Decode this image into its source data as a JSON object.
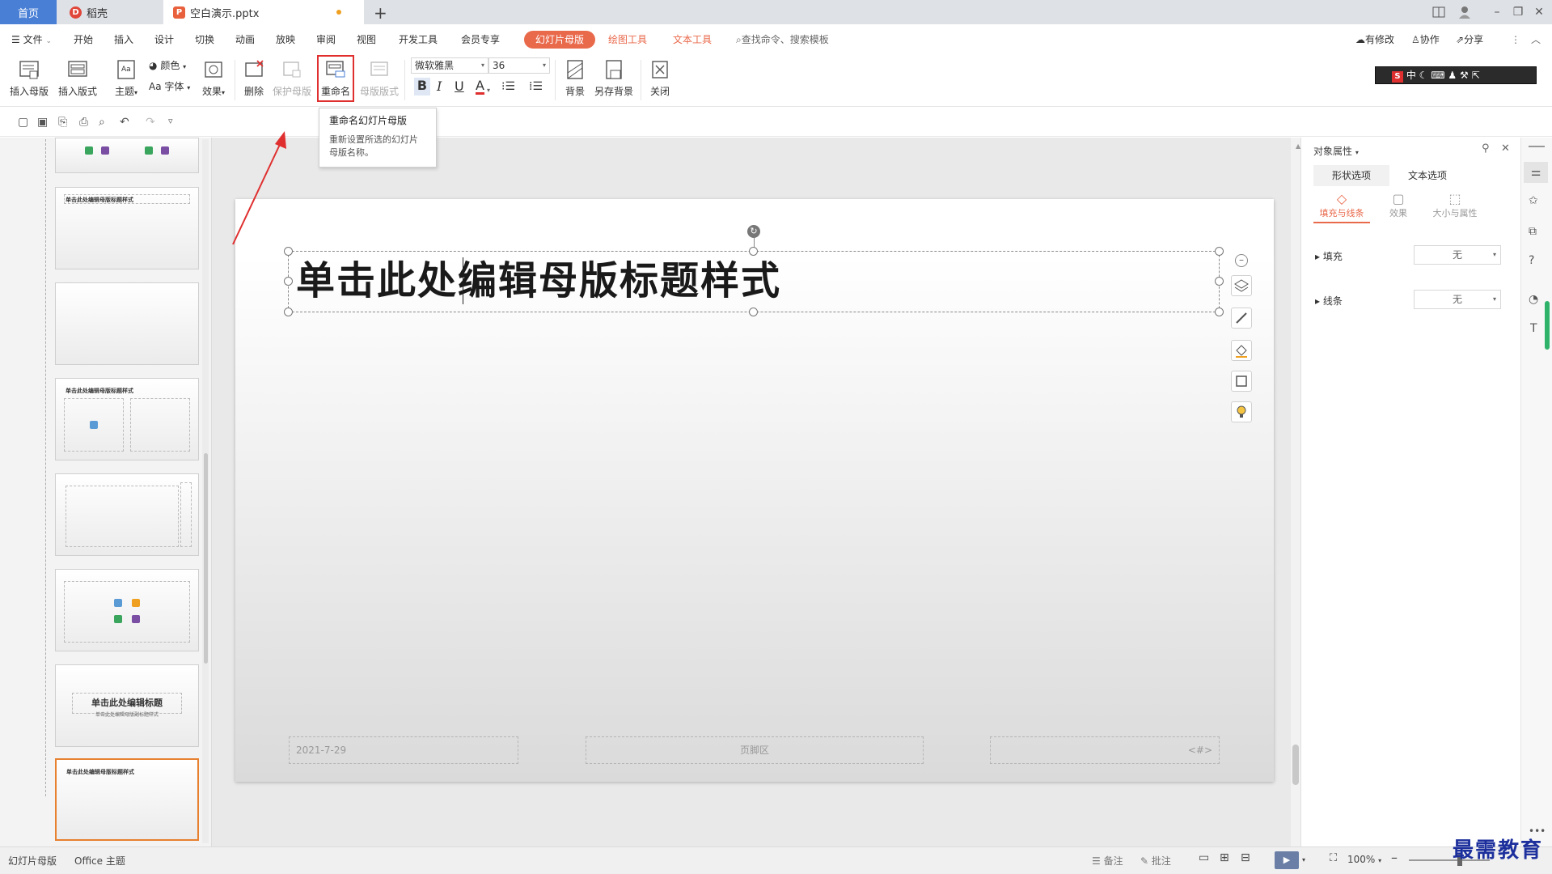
{
  "tabs": {
    "home": "首页",
    "docer": "稻壳",
    "file": "空白演示.pptx",
    "new_tab": "+"
  },
  "menu": {
    "file": "文件",
    "items": [
      "开始",
      "插入",
      "设计",
      "切换",
      "动画",
      "放映",
      "审阅",
      "视图",
      "开发工具",
      "会员专享"
    ],
    "context_master": "幻灯片母版",
    "context_draw": "绘图工具",
    "context_text": "文本工具",
    "search": "查找命令、搜索模板",
    "modified": "有修改",
    "collab": "协作",
    "share": "分享"
  },
  "ribbon": {
    "insert_master": "插入母版",
    "insert_layout": "插入版式",
    "theme": "主题",
    "color": "颜色",
    "font": "字体",
    "effect": "效果",
    "delete": "删除",
    "protect_master": "保护母版",
    "rename": "重命名",
    "master_layout": "母版版式",
    "font_name": "微软雅黑",
    "font_size": "36",
    "background": "背景",
    "save_background": "另存背景",
    "close": "关闭",
    "aa_glyph": "Aa",
    "ime_lang": "中"
  },
  "tooltip": {
    "title": "重命名幻灯片母版",
    "desc": "重新设置所选的幻灯片母版名称。"
  },
  "slide": {
    "title": "单击此处编辑母版标题样式",
    "date": "2021-7-29",
    "footer": "页脚区",
    "number": "<#>"
  },
  "thumbs": {
    "title_small": "单击此处编辑母版标题样式",
    "title_layout": "单击此处编辑标题",
    "subtitle_layout": "单击此处编辑母版副标题样式"
  },
  "right_panel": {
    "header": "对象属性",
    "tab_shape": "形状选项",
    "tab_text": "文本选项",
    "sub_fill": "填充与线条",
    "sub_effect": "效果",
    "sub_size": "大小与属性",
    "fill_label": "填充",
    "fill_value": "无",
    "line_label": "线条",
    "line_value": "无"
  },
  "status": {
    "mode": "幻灯片母版",
    "theme": "Office 主题",
    "notes": "备注",
    "comments": "批注",
    "zoom": "100%"
  },
  "watermark": "最需教育",
  "colors": {
    "accent": "#e9694b",
    "highlight_red": "#e02f2f",
    "home_tab": "#4a7fd6"
  }
}
